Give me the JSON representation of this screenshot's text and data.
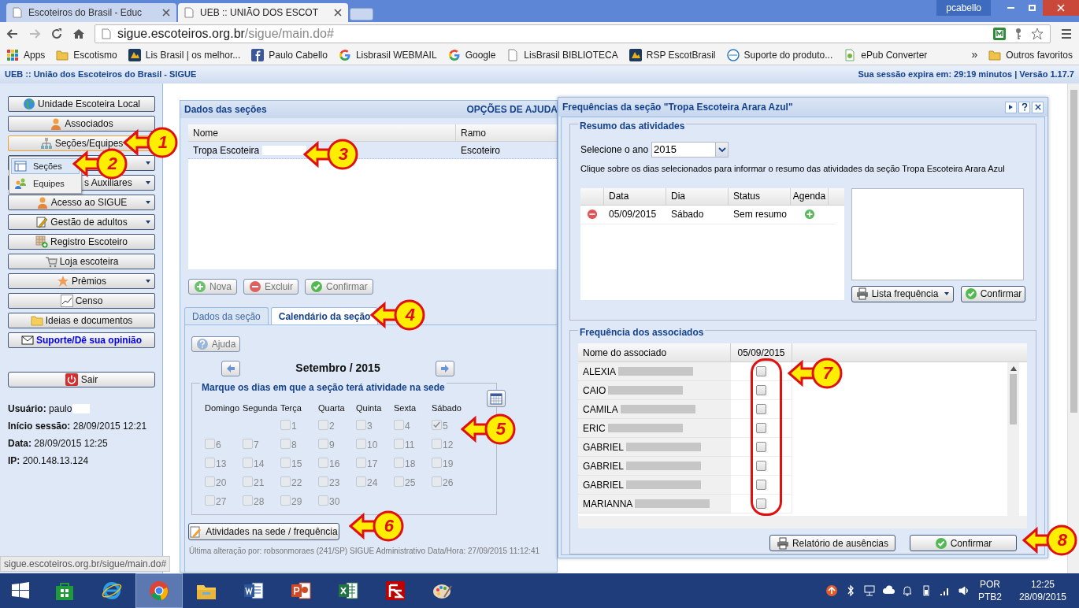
{
  "browser": {
    "tabs": [
      {
        "title": "Escoteiros do Brasil - Educ",
        "selected": false
      },
      {
        "title": "UEB :: UNIÃO DOS ESCOT",
        "selected": true
      }
    ],
    "user": "pcabello",
    "url_host": "sigue.escoteiros.org.br",
    "url_path": "/sigue/main.do#",
    "bookmarks": [
      {
        "label": "Apps"
      },
      {
        "label": "Escotismo"
      },
      {
        "label": "Lis Brasil | os melhor..."
      },
      {
        "label": "Paulo Cabello"
      },
      {
        "label": "Lisbrasil WEBMAIL"
      },
      {
        "label": "Google"
      },
      {
        "label": "LisBrasil BIBLIOTECA"
      },
      {
        "label": "RSP EscotBrasil"
      },
      {
        "label": "Suporte do produto..."
      },
      {
        "label": "ePub Converter"
      }
    ],
    "more": "»",
    "other_bookmarks": "Outros favoritos"
  },
  "app_header": {
    "title": "UEB :: União dos Escoteiros do Brasil - SIGUE",
    "session": "Sua sessão expira em: 29:19 minutos | Versão 1.17.7"
  },
  "sidebar": {
    "items": [
      {
        "label": "Unidade Escoteira Local",
        "kind": "button",
        "dropdown": false,
        "selected": false
      },
      {
        "label": "Associados",
        "kind": "button",
        "dropdown": false,
        "selected": false
      },
      {
        "label": "Seções/Equipes",
        "kind": "button",
        "dropdown": false,
        "selected": true
      },
      {
        "kind": "button",
        "dropdown": true,
        "selected": false
      },
      {
        "label": "s Auxiliares",
        "kind": "button",
        "dropdown": true,
        "selected": false
      },
      {
        "label": "Acesso ao SIGUE",
        "kind": "button",
        "dropdown": true,
        "selected": false
      },
      {
        "label": "Gestão de adultos",
        "kind": "button",
        "dropdown": true,
        "selected": false
      },
      {
        "label": "Registro Escoteiro",
        "kind": "button",
        "dropdown": false,
        "selected": false
      },
      {
        "label": "Loja escoteira",
        "kind": "button",
        "dropdown": false,
        "selected": false
      },
      {
        "label": "Prêmios",
        "kind": "button",
        "dropdown": true,
        "selected": false
      },
      {
        "label": "Censo",
        "kind": "button",
        "dropdown": false,
        "selected": false
      },
      {
        "label": "Ideias e documentos",
        "kind": "button",
        "dropdown": false,
        "selected": false
      },
      {
        "label": "Suporte/Dê sua opinião",
        "kind": "link",
        "dropdown": false,
        "selected": false
      }
    ],
    "menu": [
      {
        "label": "Seções",
        "selected": true
      },
      {
        "label": "Equipes",
        "selected": false
      }
    ],
    "logout": "Sair",
    "info": [
      {
        "label": "Usuário:",
        "value": "paulo",
        "redacted": true
      },
      {
        "label": "Início sessão:",
        "value": "28/09/2015 12:21",
        "redacted": false
      },
      {
        "label": "Data:",
        "value": "28/09/2015 12:25",
        "redacted": false
      },
      {
        "label": "IP:",
        "value": "200.148.13.124",
        "redacted": false
      }
    ]
  },
  "sections": {
    "title": "Dados das seções",
    "help": "OPÇÕES DE AJUDA",
    "columns": [
      "Nome",
      "Ramo"
    ],
    "rows": [
      {
        "cells": [
          "Tropa Escoteira",
          "Escoteiro"
        ],
        "selected": true,
        "redacted": true
      }
    ],
    "buttons": [
      {
        "label": "Nova",
        "disabled": true
      },
      {
        "label": "Excluir",
        "disabled": true
      },
      {
        "label": "Confirmar",
        "disabled": true
      }
    ],
    "tabs": [
      {
        "label": "Dados da seção",
        "selected": false
      },
      {
        "label": "Calendário da seção",
        "selected": true
      }
    ],
    "calendar": {
      "help": "Ajuda",
      "month": "Setembro / 2015",
      "legend": "Marque os dias em que a seção terá atividade na sede",
      "weekdays": [
        "Domingo",
        "Segunda",
        "Terça",
        "Quarta",
        "Quinta",
        "Sexta",
        "Sábado"
      ],
      "weeks": [
        [
          {
            "day": "1",
            "checked": false
          },
          {
            "day": "2",
            "checked": false
          },
          {
            "day": "3",
            "checked": false
          },
          {
            "day": "4",
            "checked": false
          },
          {
            "day": "5",
            "checked": true
          }
        ],
        [
          {
            "day": "6",
            "checked": false
          },
          {
            "day": "7",
            "checked": false
          },
          {
            "day": "8",
            "checked": false
          },
          {
            "day": "9",
            "checked": false
          },
          {
            "day": "10",
            "checked": false
          },
          {
            "day": "11",
            "checked": false
          },
          {
            "day": "12",
            "checked": false
          }
        ],
        [
          {
            "day": "13",
            "checked": false
          },
          {
            "day": "14",
            "checked": false
          },
          {
            "day": "15",
            "checked": false
          },
          {
            "day": "16",
            "checked": false
          },
          {
            "day": "17",
            "checked": false
          },
          {
            "day": "18",
            "checked": false
          },
          {
            "day": "19",
            "checked": false
          }
        ],
        [
          {
            "day": "20",
            "checked": false
          },
          {
            "day": "21",
            "checked": false
          },
          {
            "day": "22",
            "checked": false
          },
          {
            "day": "23",
            "checked": false
          },
          {
            "day": "24",
            "checked": false
          },
          {
            "day": "25",
            "checked": false
          },
          {
            "day": "26",
            "checked": false
          }
        ],
        [
          {
            "day": "27",
            "checked": false
          },
          {
            "day": "28",
            "checked": false
          },
          {
            "day": "29",
            "checked": false
          },
          {
            "day": "30",
            "checked": false
          }
        ]
      ]
    },
    "action": "Atividades na sede / frequência",
    "footnote": "Última alteração por: robsonmoraes (241/SP) SIGUE Administrativo Data/Hora: 27/09/2015 11:12:41"
  },
  "dialog": {
    "title": "Frequências da seção \"Tropa Escoteira Arara Azul\"",
    "summary": {
      "legend": "Resumo das atividades",
      "year_label": "Selecione o ano",
      "year": "2015",
      "hint": "Clique sobre os dias selecionados para informar o resumo das atividades da seção Tropa Escoteira Arara Azul",
      "columns": [
        "Data",
        "Dia",
        "Status",
        "Agenda"
      ],
      "rows": [
        {
          "date": "05/09/2015",
          "day": "Sábado",
          "status": "Sem resumo"
        }
      ],
      "list_button": "Lista frequência",
      "confirm": "Confirmar"
    },
    "attendance": {
      "legend": "Frequência dos associados",
      "columns": [
        "Nome do associado",
        "05/09/2015"
      ],
      "members": [
        {
          "name": "ALEXIA",
          "present": false
        },
        {
          "name": "CAIO",
          "present": false
        },
        {
          "name": "CAMILA",
          "present": false
        },
        {
          "name": "ERIC",
          "present": false
        },
        {
          "name": "GABRIEL",
          "present": false
        },
        {
          "name": "GABRIEL",
          "present": false
        },
        {
          "name": "GABRIEL",
          "present": false
        },
        {
          "name": "MARIANNA",
          "present": false
        }
      ],
      "report": "Relatório de ausências",
      "confirm": "Confirmar"
    }
  },
  "callouts": [
    {
      "label": "1"
    },
    {
      "label": "2"
    },
    {
      "label": "3"
    },
    {
      "label": "4"
    },
    {
      "label": "5"
    },
    {
      "label": "6"
    },
    {
      "label": "7"
    },
    {
      "label": "8"
    }
  ],
  "status_url": "sigue.escoteiros.org.br/sigue/main.do#",
  "taskbar": {
    "apps": [
      {
        "kind": "store",
        "selected": false
      },
      {
        "kind": "ie",
        "selected": false
      },
      {
        "kind": "chrome",
        "selected": true
      },
      {
        "kind": "explorer",
        "selected": false
      },
      {
        "kind": "word",
        "selected": false
      },
      {
        "kind": "powerpoint",
        "selected": false
      },
      {
        "kind": "excel",
        "selected": false
      },
      {
        "kind": "filezilla",
        "selected": false
      },
      {
        "kind": "paint",
        "selected": false
      }
    ],
    "lang": "POR",
    "layout": "PTB2",
    "time": "12:25",
    "date": "28/09/2015"
  }
}
